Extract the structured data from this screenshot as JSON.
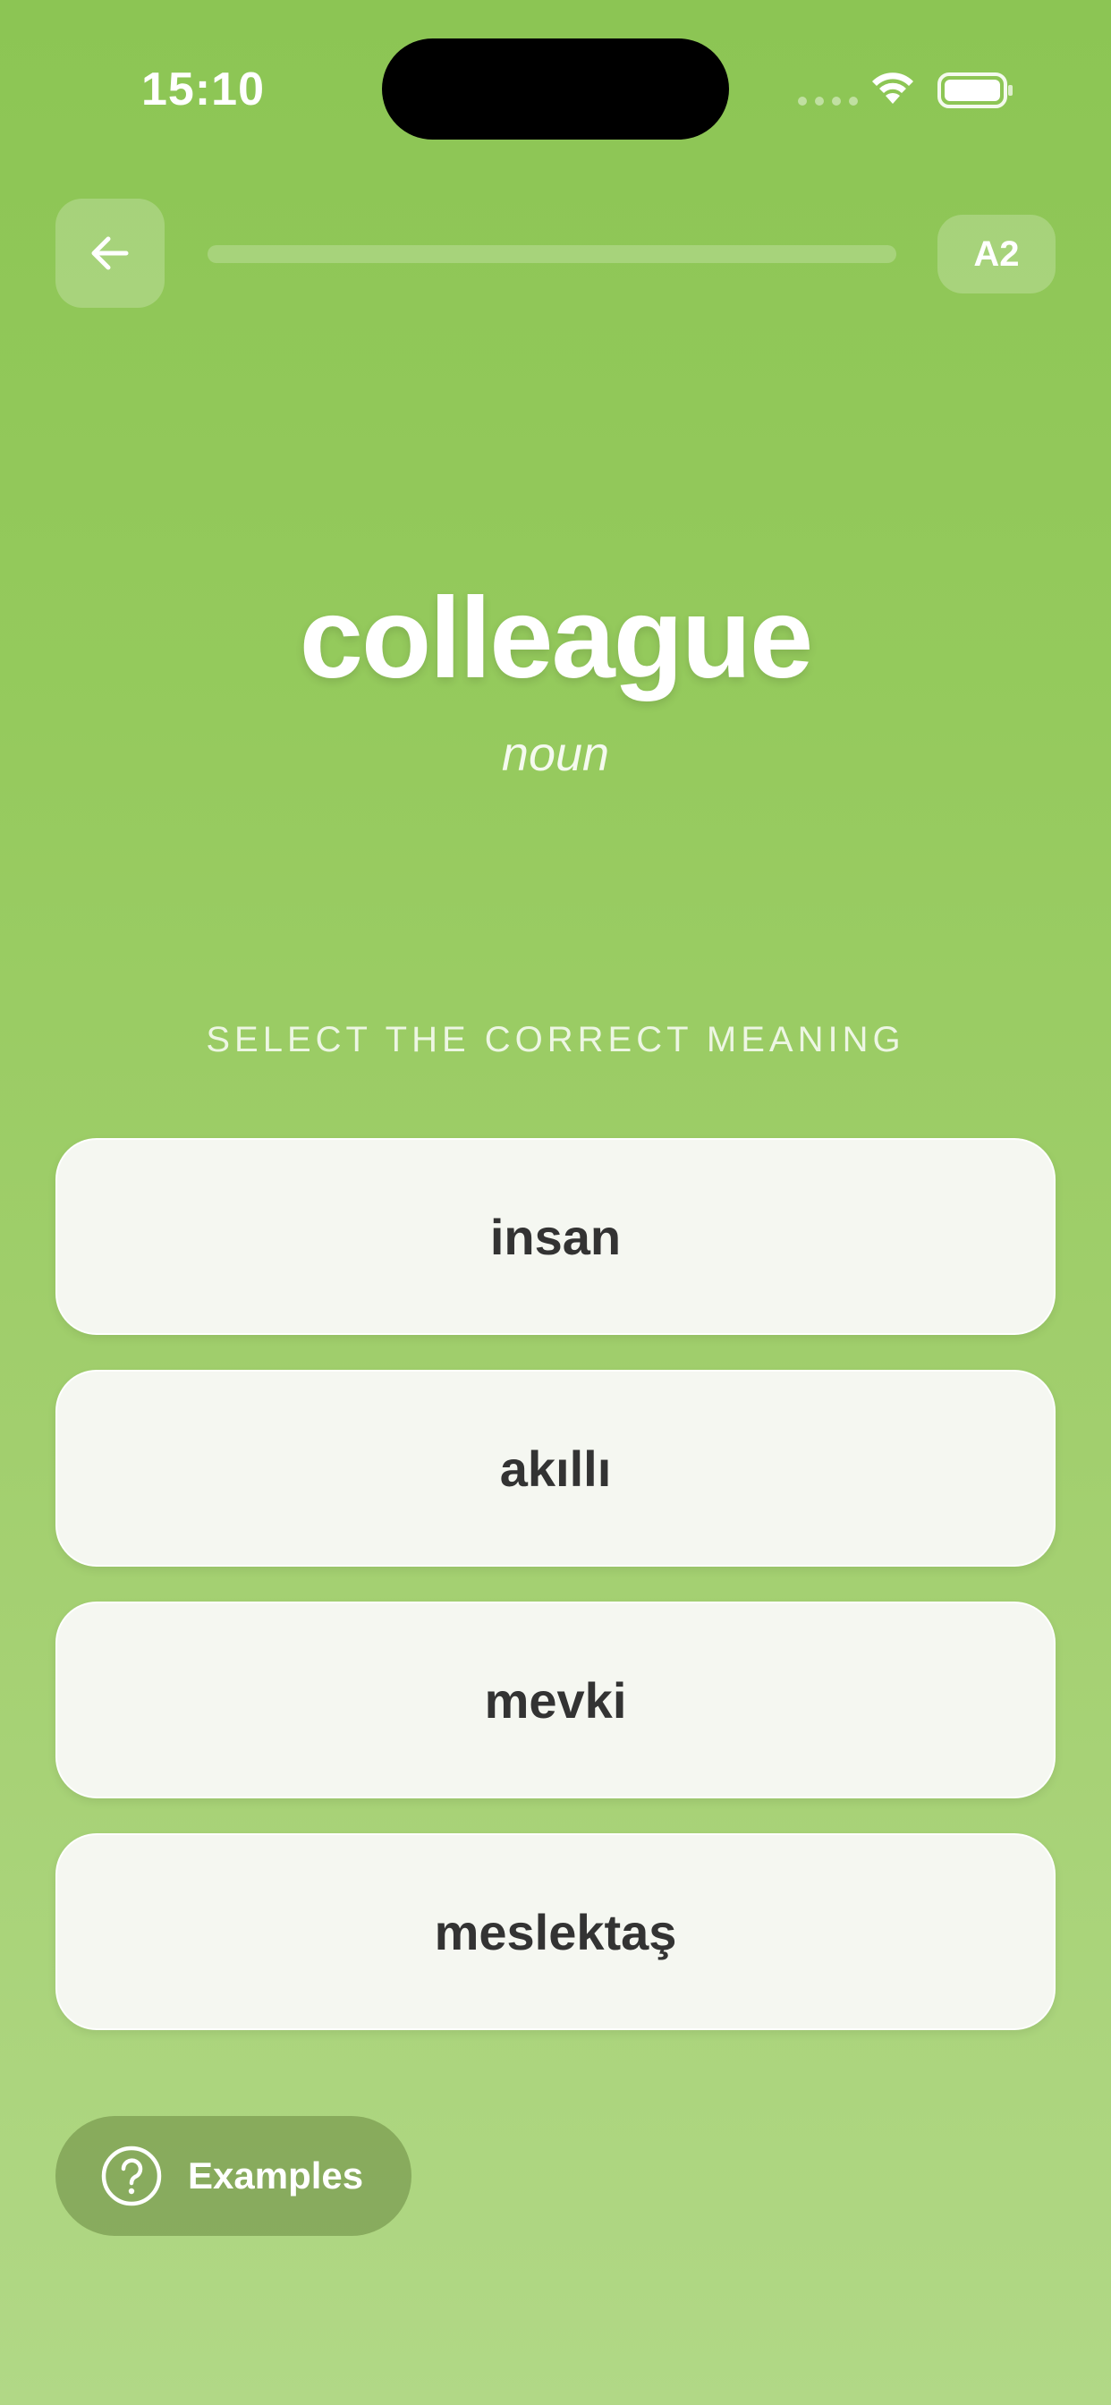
{
  "status_bar": {
    "time": "15:10",
    "wifi_icon": "wifi-icon",
    "battery_icon": "battery-icon"
  },
  "top_bar": {
    "back_icon": "arrow-left-icon",
    "progress_fraction": 0.0,
    "level": "A2"
  },
  "word": {
    "text": "colleague",
    "part_of_speech": "noun"
  },
  "prompt": "SELECT THE CORRECT MEANING",
  "options": [
    {
      "label": "insan"
    },
    {
      "label": "akıllı"
    },
    {
      "label": "mevki"
    },
    {
      "label": "meslektaş"
    }
  ],
  "examples_button": {
    "icon": "question-circle-icon",
    "label": "Examples"
  },
  "colors": {
    "background_top": "#8cc554",
    "background_bottom": "#b1d886",
    "option_bg": "#f5f7f1",
    "option_text": "#333333"
  }
}
